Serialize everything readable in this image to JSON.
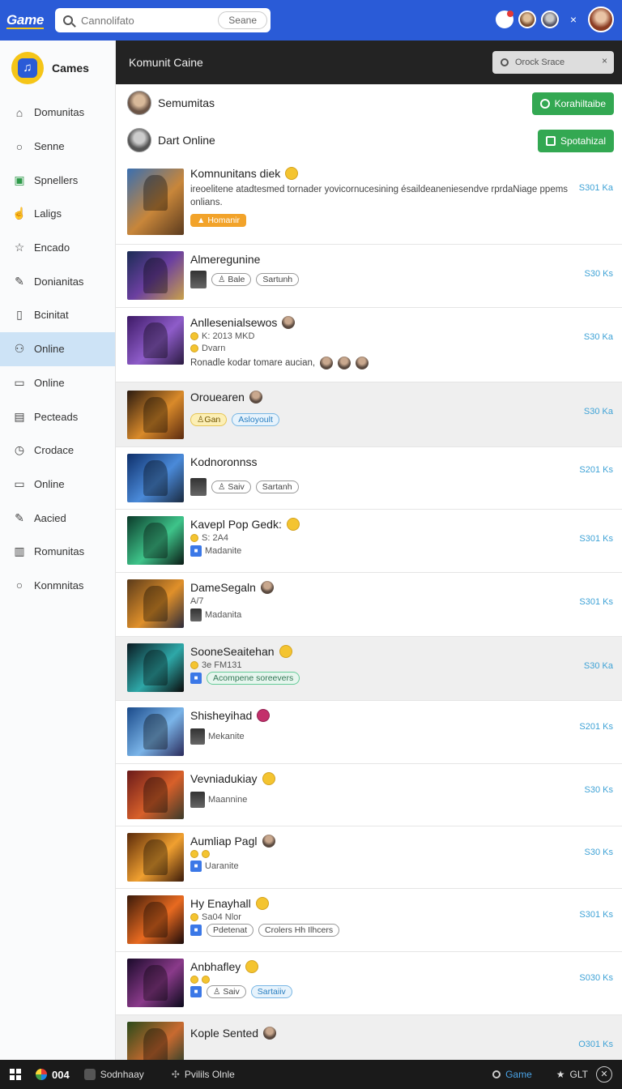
{
  "topbar": {
    "logo": "Game",
    "search_placeholder": "Cannolifato",
    "search_button": "Seane",
    "close_glyph": "×"
  },
  "sidebar": {
    "brand": "Cames",
    "items": [
      {
        "label": "Domunitas",
        "icon": "home-icon"
      },
      {
        "label": "Senne",
        "icon": "search-icon"
      },
      {
        "label": "Spnellers",
        "icon": "players-icon"
      },
      {
        "label": "Laligs",
        "icon": "like-icon"
      },
      {
        "label": "Encado",
        "icon": "star-icon"
      },
      {
        "label": "Donianitas",
        "icon": "edit-icon"
      },
      {
        "label": "Bcinitat",
        "icon": "document-icon"
      },
      {
        "label": "Online",
        "icon": "people-icon",
        "active": true
      },
      {
        "label": "Online",
        "icon": "file-icon"
      },
      {
        "label": "Pecteads",
        "icon": "page-icon"
      },
      {
        "label": "Crodace",
        "icon": "clock-icon"
      },
      {
        "label": "Online",
        "icon": "folder-icon"
      },
      {
        "label": "Aacied",
        "icon": "pencil-icon"
      },
      {
        "label": "Romunitas",
        "icon": "clipboard-icon"
      },
      {
        "label": "Konmnitas",
        "icon": "chat-icon"
      }
    ]
  },
  "header": {
    "title": "Komunit Caine",
    "search_placeholder": "Orock Srace"
  },
  "friends": [
    {
      "name": "Semumitas",
      "button": "Korahiltaibe"
    },
    {
      "name": "Dart Online",
      "button": "Spotahizal"
    }
  ],
  "items": [
    {
      "title": "Komnunitans diek",
      "desc": "ireoelitene atadtesmed tornader yovicornucesining ésaildeaneniesendve rprdaNiage ppems onlians.",
      "tag": "Homanir",
      "price": "S301 Ka"
    },
    {
      "title": "Almeregunine",
      "pills": [
        "Bale",
        "Sartunh"
      ],
      "price": "S30 Ks"
    },
    {
      "title": "Anllesenialsewos",
      "sub1": "K: 2013 MKD",
      "sub2": "Dvarn",
      "line": "Ronadle kodar tomare aucian,",
      "price": "S30 Ka"
    },
    {
      "title": "Orouearen",
      "pills": [
        "Gan",
        "Asloyoult"
      ],
      "price": "S30 Ka"
    },
    {
      "title": "Kodnoronnss",
      "pills": [
        "Saiv",
        "Sartanh"
      ],
      "price": "S201 Ks"
    },
    {
      "title": "Kavepl Pop Gedk:",
      "sub1": "S: 2A4",
      "sub2": "Madanite",
      "price": "S301 Ks"
    },
    {
      "title": "DameSegaln",
      "sub1": "A/7",
      "sub2": "Madanita",
      "price": "S301 Ks"
    },
    {
      "title": "SooneSeaitehan",
      "sub1": "3e FM131",
      "pills": [
        "Acompene soreevers"
      ],
      "price": "S30 Ka"
    },
    {
      "title": "Shisheyihad",
      "sub2": "Mekanite",
      "price": "S201 Ks"
    },
    {
      "title": "Vevniadukiay",
      "sub2": "Maannine",
      "price": "S30 Ks"
    },
    {
      "title": "Aumliap Pagl",
      "sub2": "Uaranite",
      "price": "S30 Ks"
    },
    {
      "title": "Hy Enayhall",
      "sub1": "Sa04 Nlor",
      "pills": [
        "Pdetenat",
        "Crolers Hh Ilhcers"
      ],
      "price": "S301 Ks"
    },
    {
      "title": "Anbhafley",
      "pills": [
        "Saiv",
        "Sartaiiv"
      ],
      "price": "S030 Ks"
    },
    {
      "title": "Kople Sented",
      "price": "O301 Ks"
    }
  ],
  "taskbar": {
    "num": "004",
    "item1": "Sodnhaay",
    "item2": "Pvilils Olnle",
    "game": "Game",
    "right": "GLT"
  },
  "colors": {
    "topbar": "#2a5bd7",
    "header": "#232323",
    "active_nav": "#cde3f6",
    "green_button": "#33a852",
    "price": "#3ea2d6"
  }
}
